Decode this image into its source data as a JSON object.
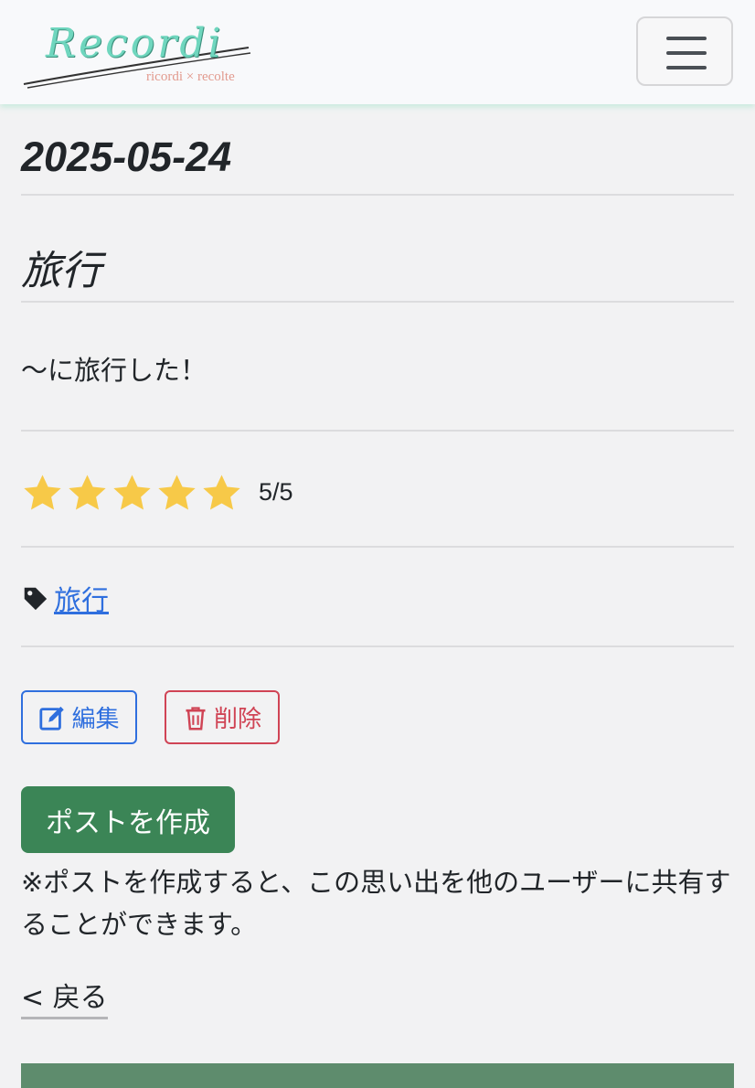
{
  "header": {
    "logo_title": "Recordi",
    "logo_subtitle": "ricordi × recolte",
    "menu_icon": "hamburger-icon"
  },
  "memory": {
    "date": "2025-05-24",
    "title": "旅行",
    "body": "〜に旅行した！",
    "rating": 5,
    "rating_max": 5,
    "rating_text": "5/5",
    "star_color": "#f7c948",
    "tag_icon": "tag-icon",
    "tag": "旅行"
  },
  "actions": {
    "edit_label": "編集",
    "edit_icon": "pencil-square-icon",
    "delete_label": "削除",
    "delete_icon": "trash-icon",
    "post_label": "ポストを作成",
    "post_note": "※ポストを作成すると、この思い出を他のユーザーに共有することができます。",
    "back_label": "< 戻る"
  },
  "colors": {
    "primary": "#2f6fde",
    "danger": "#d04455",
    "success": "#3b8556",
    "logo": "#6fd6be",
    "footer": "#5e8c6d"
  }
}
